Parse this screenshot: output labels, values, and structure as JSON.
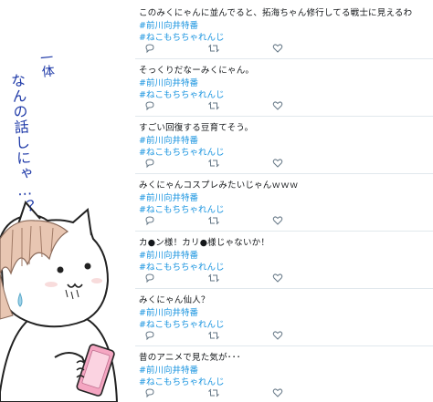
{
  "caption": {
    "line1": "一体",
    "line2": "なんの話しにゃ…？"
  },
  "tweets": [
    {
      "text": "このみくにゃんに並んでると、拓海ちゃん修行してる戦士に見えるわ",
      "hashtags": [
        "#前川向井特番",
        "#ねこもちちゃれんじ"
      ]
    },
    {
      "text": "そっくりだなーみくにゃん。",
      "hashtags": [
        "#前川向井特番",
        "#ねこもちちゃれんじ"
      ]
    },
    {
      "text": "すごい回復する豆育てそう。",
      "hashtags": [
        "#前川向井特番",
        "#ねこもちちゃれんじ"
      ]
    },
    {
      "text": "みくにゃんコスプレみたいじゃんｗｗｗ",
      "hashtags": [
        "#前川向井特番",
        "#ねこもちちゃれんじ"
      ]
    },
    {
      "text": "カ●ン様！カリ●様じゃないか！",
      "hashtags": [
        "#前川向井特番",
        "#ねこもちちゃれんじ"
      ]
    },
    {
      "text": "みくにゃん仙人？",
      "hashtags": [
        "#前川向井特番",
        "#ねこもちちゃれんじ"
      ]
    },
    {
      "text": "昔のアニメで見た気が･･･",
      "hashtags": [
        "#前川向井特番",
        "#ねこもちちゃれんじ"
      ]
    }
  ],
  "icons": {
    "reply": "reply-icon",
    "retweet": "retweet-icon",
    "like": "heart-icon"
  },
  "colors": {
    "text": "#14171a",
    "hashtag": "#1b95e0",
    "action": "#657786",
    "divider": "#e1e8ed",
    "caption": "#1f3aa8",
    "phone": "#f5a6c2",
    "hair": "#e8c6b2"
  }
}
